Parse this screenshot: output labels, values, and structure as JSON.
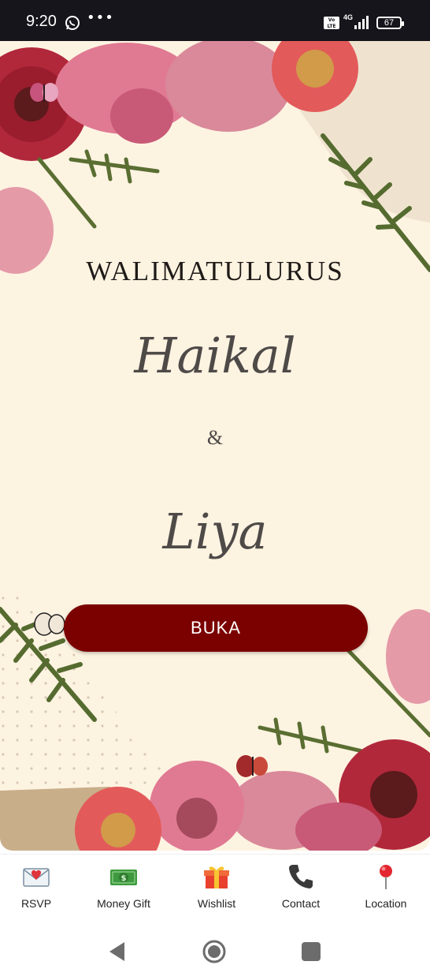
{
  "status_bar": {
    "time": "9:20",
    "overflow": "•••",
    "volte": "Vo LTE",
    "network": "4G",
    "battery": "67",
    "icons": [
      "whatsapp-icon",
      "volte-icon",
      "signal-icon",
      "battery-icon"
    ]
  },
  "invitation": {
    "title": "WALIMATULURUS",
    "groom": "Haikal",
    "ampersand": "&",
    "bride": "Liya",
    "open_button": "BUKA",
    "colors": {
      "background": "#fdf3e1",
      "button": "#7b0000",
      "title": "#1e1a17",
      "names": "#4e4a48"
    }
  },
  "bottom_nav": {
    "items": [
      {
        "label": "RSVP",
        "icon": "envelope-heart-icon"
      },
      {
        "label": "Money Gift",
        "icon": "money-icon"
      },
      {
        "label": "Wishlist",
        "icon": "gift-icon"
      },
      {
        "label": "Contact",
        "icon": "phone-icon"
      },
      {
        "label": "Location",
        "icon": "location-pin-icon"
      }
    ]
  },
  "system_nav": {
    "icons": [
      "back-icon",
      "home-icon",
      "recents-icon"
    ]
  }
}
